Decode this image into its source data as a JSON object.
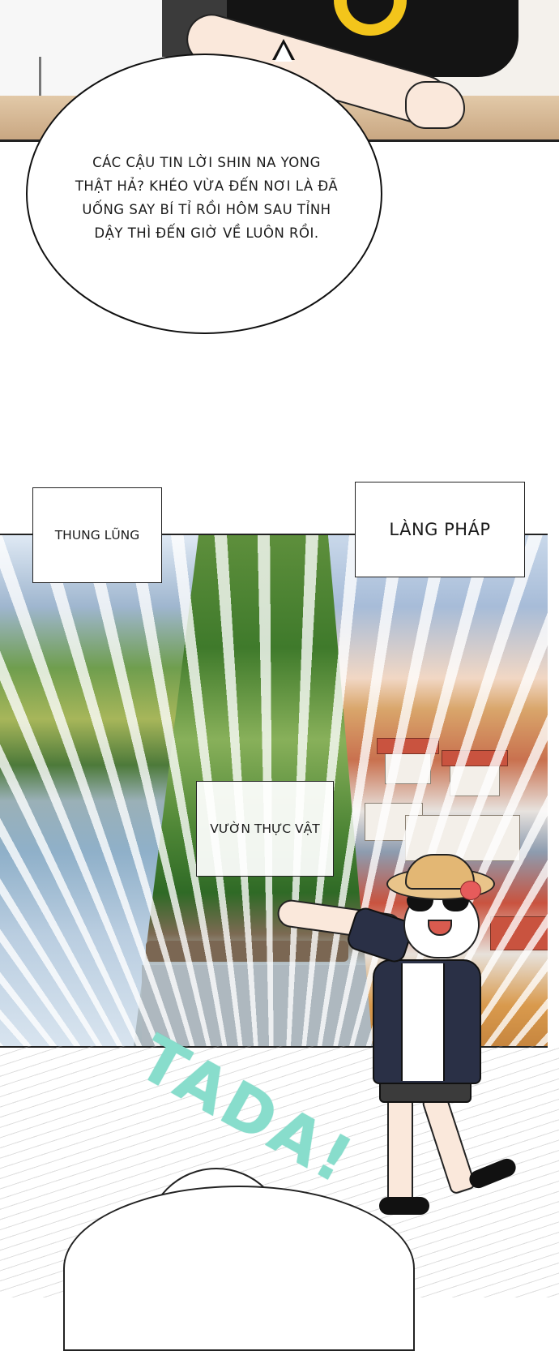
{
  "speech_bubble": {
    "text": "CÁC CẬU TIN LỜI SHIN NA YONG\nTHẬT HẢ? KHÉO VỪA ĐẾN NƠI LÀ ĐÃ\nUỐNG SAY BÍ TỈ RỒI HÔM SAU TỈNH\nDẬY THÌ ĐẾN GIỜ VỀ LUÔN RỒI."
  },
  "captions": {
    "valley": "THUNG LŨNG",
    "village": "LÀNG PHÁP",
    "garden": "VƯỜN THỰC VẬT"
  },
  "sound_effect": {
    "text": "TADA!",
    "color": "#88ddcc"
  },
  "icons": [
    "batman-logo-icon",
    "sunglasses-icon",
    "flower-icon"
  ]
}
